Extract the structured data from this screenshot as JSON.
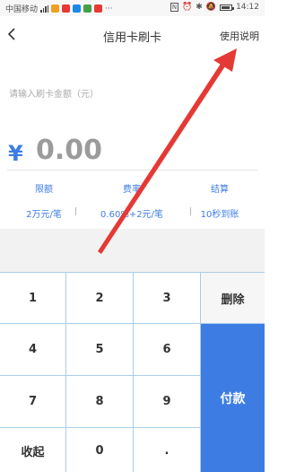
{
  "status_bar": {
    "carrier": "中国移动",
    "time": "14:12",
    "battery_level": 0.85,
    "app_icon_colors": [
      "#f0a020",
      "#e53935",
      "#1e88e5",
      "#43a047",
      "#e53935"
    ]
  },
  "header": {
    "back_icon": "chevron-left-icon",
    "title": "信用卡刷卡",
    "help_label": "使用说明"
  },
  "amount": {
    "placeholder_label": "请输入刷卡金额（元）",
    "currency_symbol": "¥",
    "value": "0.00"
  },
  "info": [
    {
      "heading": "限额",
      "value": "2万元/笔"
    },
    {
      "heading": "费率",
      "value": "0.60%+2元/笔"
    },
    {
      "heading": "结算",
      "value": "10秒到账"
    }
  ],
  "keypad": {
    "digits": [
      "1",
      "2",
      "3",
      "4",
      "5",
      "6",
      "7",
      "8",
      "9"
    ],
    "collapse_label": "收起",
    "zero_label": "0",
    "dot_label": ".",
    "delete_label": "删除",
    "pay_label": "付款"
  },
  "colors": {
    "accent": "#3d7de3",
    "annotation": "#e53935",
    "grid_line": "#a8cdea"
  }
}
